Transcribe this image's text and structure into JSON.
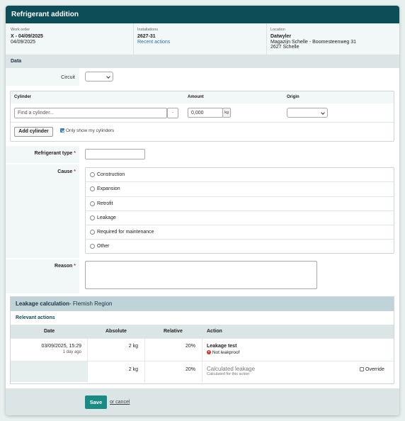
{
  "title": "Refrigerant addition",
  "info": {
    "work_order_label": "Work order",
    "work_order_name": "X - 04/09/2025",
    "work_order_date": "04/09/2025",
    "installations_label": "Installations",
    "installation_id": "2627-31",
    "recent_actions_link": "Recent actions",
    "location_label": "Location",
    "location_name": "Datwyler",
    "location_address": "Magazijn Schelle - Boomesteenweg 31",
    "location_city": "2627 Schelle"
  },
  "data_section": "Data",
  "circuit_label": "Circuit",
  "cylinder": {
    "col_cylinder": "Cylinder",
    "col_amount": "Amount",
    "col_origin": "Origin",
    "find_placeholder": "Find a cylinder...",
    "dash": "-",
    "amount_value": "0,000",
    "unit": "kg",
    "add_button": "Add cylinder",
    "only_mine_label": "Only show my cylinders",
    "only_mine_checked": true
  },
  "refrigerant_type_label": "Refrigerant type",
  "required_mark": "*",
  "cause_label": "Cause",
  "causes": [
    "Construction",
    "Expansion",
    "Retrofit",
    "Leakage",
    "Required for maintenance",
    "Other"
  ],
  "reason_label": "Reason",
  "leakage": {
    "title": "Leakage calculation",
    "region": "- Flemish Region",
    "relevant_actions": "Relevant actions",
    "headers": [
      "Date",
      "Absolute",
      "Relative",
      "Action"
    ],
    "row1": {
      "date": "03/09/2025, 15:29",
      "ago": "1 day ago",
      "absolute": "2 kg",
      "relative": "20%",
      "action": "Leakage test",
      "status": "Not leakproof",
      "status_color": "#d6332b"
    },
    "row2": {
      "absolute": "2 kg",
      "relative": "20%",
      "action": "Calculated leakage",
      "sub": "Calculated for this action",
      "override_label": "Override"
    }
  },
  "save_button": "Save",
  "cancel_link": "or cancel",
  "colors": {
    "header": "#0d4d58",
    "save": "#1a8a85",
    "link": "#2a6fb8"
  }
}
